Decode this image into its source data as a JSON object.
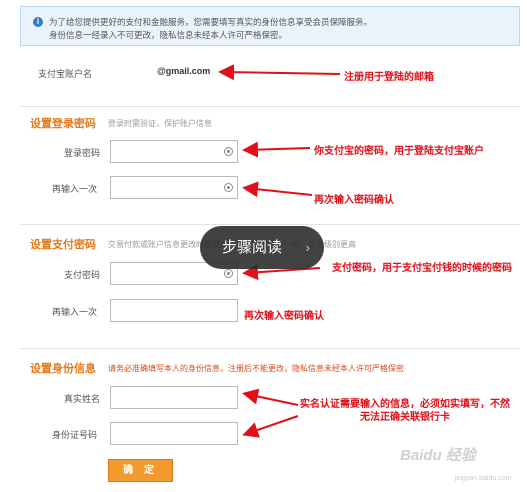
{
  "notice": {
    "icon": "info-icon",
    "line1": "为了给您提供更好的支付和金融服务，您需要填写真实的身份信息享受会员保障服务。",
    "line2": "身份信息一经录入不可更改，隐私信息未经本人许可严格保密。"
  },
  "account": {
    "label": "支付宝账户名",
    "value": "@gmail.com",
    "annotation": "注册用于登陆的邮箱"
  },
  "login_section": {
    "title": "设置登录密码",
    "desc": "登录时需验证，保护账户信息",
    "field1_label": "登录密码",
    "field2_label": "再输入一次",
    "annotation1": "你支付宝的密码，用于登陆支付宝账户",
    "annotation2": "再次输入密码确认"
  },
  "pay_section": {
    "title": "设置支付密码",
    "desc": "交易付款或账户信息更改时需输入，与登录密码不一样，安全级别更高",
    "field1_label": "支付密码",
    "field2_label": "再输入一次",
    "annotation1": "支付密码，用于支付宝付钱的时候的密码",
    "annotation2": "再次输入密码确认"
  },
  "identity_section": {
    "title": "设置身份信息",
    "desc": "请务必准确填写本人的身份信息，注册后不能更改，隐私信息未经本人许可严格保密",
    "field1_label": "真实姓名",
    "field2_label": "身份证号码",
    "annotation": "实名认证需要输入的信息，必须如实填写，不然无法正确关联银行卡"
  },
  "confirm_button": "确 定",
  "step_overlay": {
    "label": "步骤阅读",
    "chevron": "›"
  },
  "watermark": {
    "brand": "Baidu 经验",
    "url": "jingyan.baidu.com"
  },
  "colors": {
    "annotation_red": "#e0101a",
    "section_orange": "#e57a1c",
    "button_orange": "#f29a2e"
  }
}
